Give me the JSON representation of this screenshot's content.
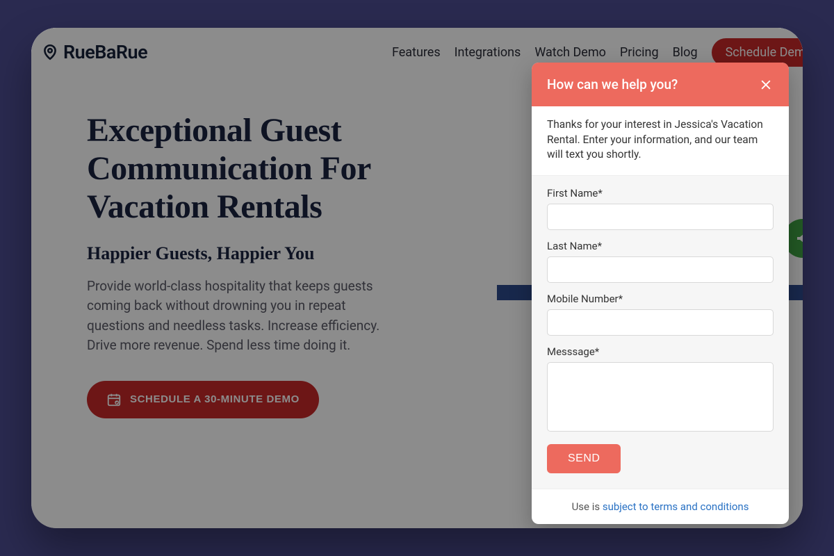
{
  "brand": {
    "name": "RueBaRue"
  },
  "nav": {
    "items": [
      "Features",
      "Integrations",
      "Watch Demo",
      "Pricing",
      "Blog"
    ],
    "cta": "Schedule Demo"
  },
  "hero": {
    "title": "Exceptional Guest Communication For Vacation Rentals",
    "subtitle": "Happier Guests, Happier You",
    "body": "Provide world-class hospitality that keeps guests coming back without drowning you in repeat questions and needless tasks. Increase efficiency. Drive more revenue. Spend less time doing it.",
    "cta": "SCHEDULE A 30-MINUTE DEMO"
  },
  "chat": {
    "title": "How can we help you?",
    "intro": "Thanks for your interest in Jessica's Vacation Rental. Enter your information, and our team will text you shortly.",
    "fields": {
      "first_name": "First Name*",
      "last_name": "Last Name*",
      "mobile": "Mobile Number*",
      "message": "Messsage*"
    },
    "send": "SEND",
    "footer_prefix": "Use is ",
    "footer_link": "subject to terms and conditions"
  }
}
